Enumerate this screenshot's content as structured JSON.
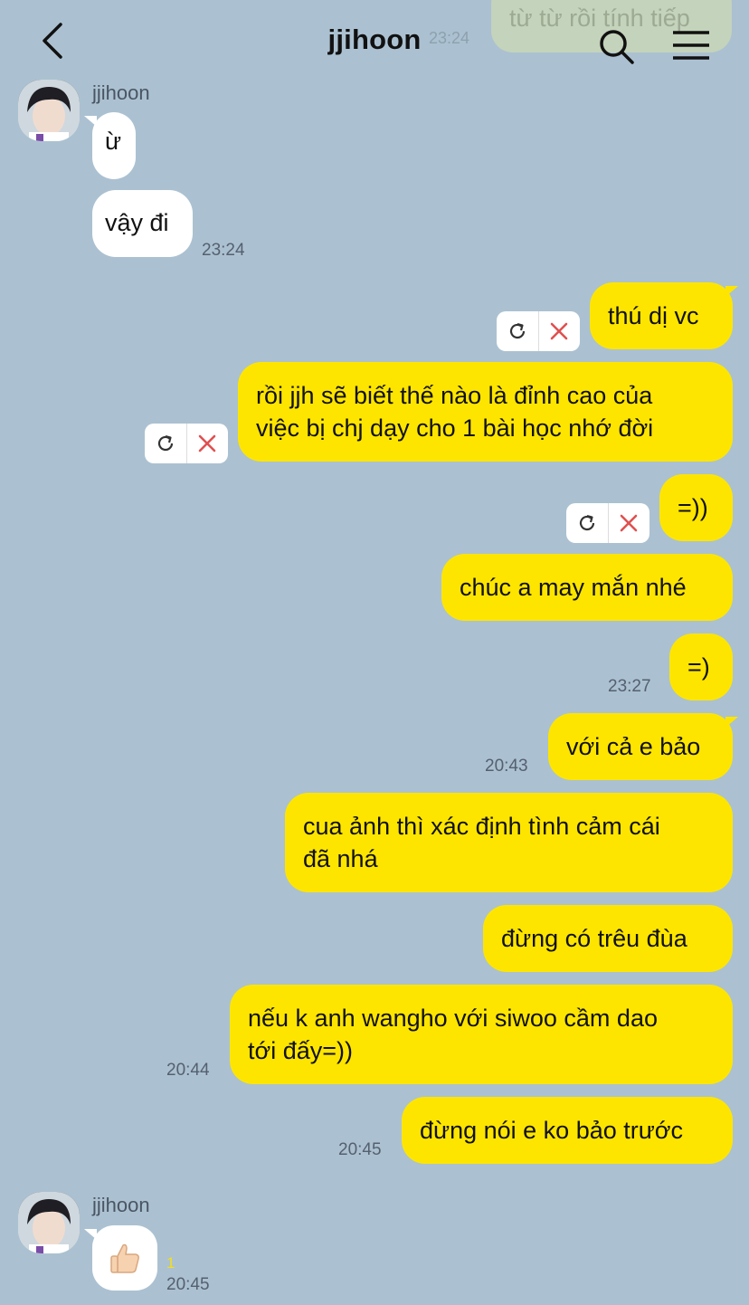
{
  "header": {
    "title": "jjihoon",
    "ghost_message": "từ từ rồi tính tiếp",
    "ghost_time": "23:24"
  },
  "messages": [
    {
      "id": "m1",
      "side": "them",
      "sender": "jjihoon",
      "text": "ừ"
    },
    {
      "id": "m2",
      "side": "them",
      "text": "vậy đi",
      "time": "23:24"
    },
    {
      "id": "m3",
      "side": "me",
      "text": "thú dị vc",
      "failed": true
    },
    {
      "id": "m4",
      "side": "me",
      "text": [
        "rồi jjh sẽ biết thế nào là đỉnh cao của",
        "việc bị chj dạy cho 1 bài học nhớ đời"
      ],
      "failed": true
    },
    {
      "id": "m5",
      "side": "me",
      "text": "=))",
      "failed": true
    },
    {
      "id": "m6",
      "side": "me",
      "text": "chúc a may mắn nhé"
    },
    {
      "id": "m7",
      "side": "me",
      "text": "=)",
      "time": "23:27"
    },
    {
      "id": "m8",
      "side": "me",
      "text": "với cả e bảo",
      "time": "20:43"
    },
    {
      "id": "m9",
      "side": "me",
      "text": [
        "cua ảnh thì xác định tình cảm cái",
        "đã nhá"
      ]
    },
    {
      "id": "m10",
      "side": "me",
      "text": "đừng có trêu đùa"
    },
    {
      "id": "m11",
      "side": "me",
      "text": [
        "nếu k anh wangho với siwoo cầm dao",
        "tới đấy=))"
      ],
      "time": "20:44"
    },
    {
      "id": "m12",
      "side": "me",
      "text": "đừng nói e ko bảo trước",
      "time": "20:45"
    },
    {
      "id": "m13",
      "side": "them",
      "sender": "jjihoon",
      "sticker": "thumbs-up",
      "unread": "1",
      "time": "20:45"
    }
  ],
  "icons": {
    "back": "chevron-left-icon",
    "search": "search-icon",
    "menu": "hamburger-menu-icon",
    "retry": "refresh-icon",
    "delete": "close-icon"
  },
  "colors": {
    "background": "#abc1d1",
    "my_bubble": "#fee500",
    "their_bubble": "#ffffff",
    "delete_x": "#e05050",
    "unread": "#f3df1a"
  }
}
